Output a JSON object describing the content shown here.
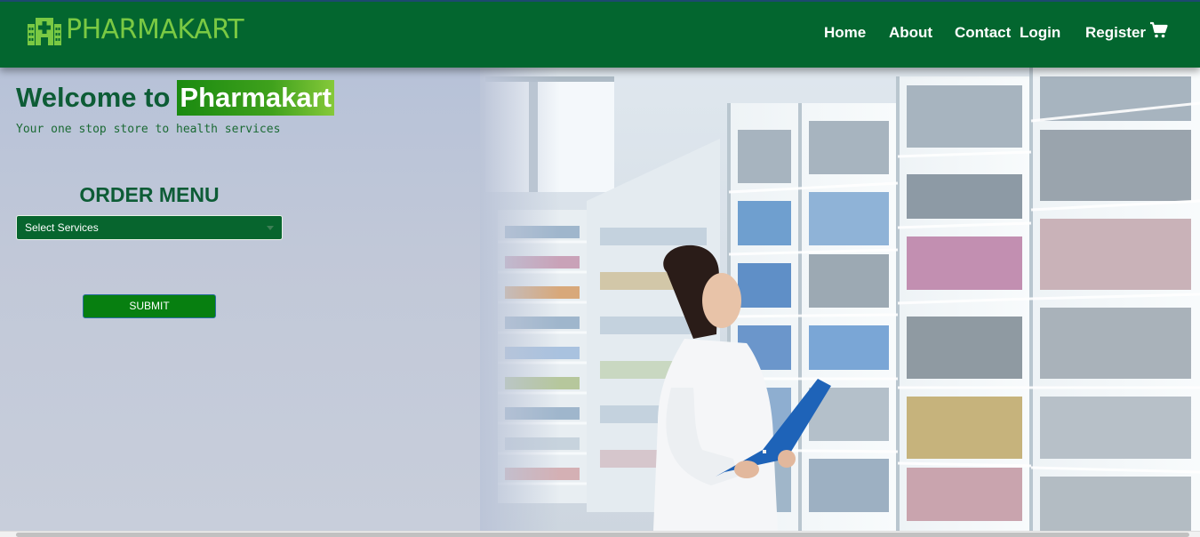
{
  "brand": {
    "name": "PHARMAKART",
    "logo_icon": "pharmacy-building-icon",
    "logo_color": "#7ac943"
  },
  "nav": {
    "items": [
      {
        "label": "Home"
      },
      {
        "label": "About"
      },
      {
        "label": "Contact"
      },
      {
        "label": "Login"
      },
      {
        "label": "Register"
      }
    ],
    "cart_icon": "shopping-cart-icon"
  },
  "hero": {
    "welcome_prefix": "Welcome to",
    "welcome_brand": "Pharmakart",
    "tagline": "Your one stop store to health services",
    "order_title": "ORDER MENU",
    "select": {
      "selected": "Select Services"
    },
    "submit_label": "SUBMIT"
  },
  "colors": {
    "header_bg": "#03662f",
    "accent_green": "#077f10",
    "text_green": "#0d5c36"
  }
}
